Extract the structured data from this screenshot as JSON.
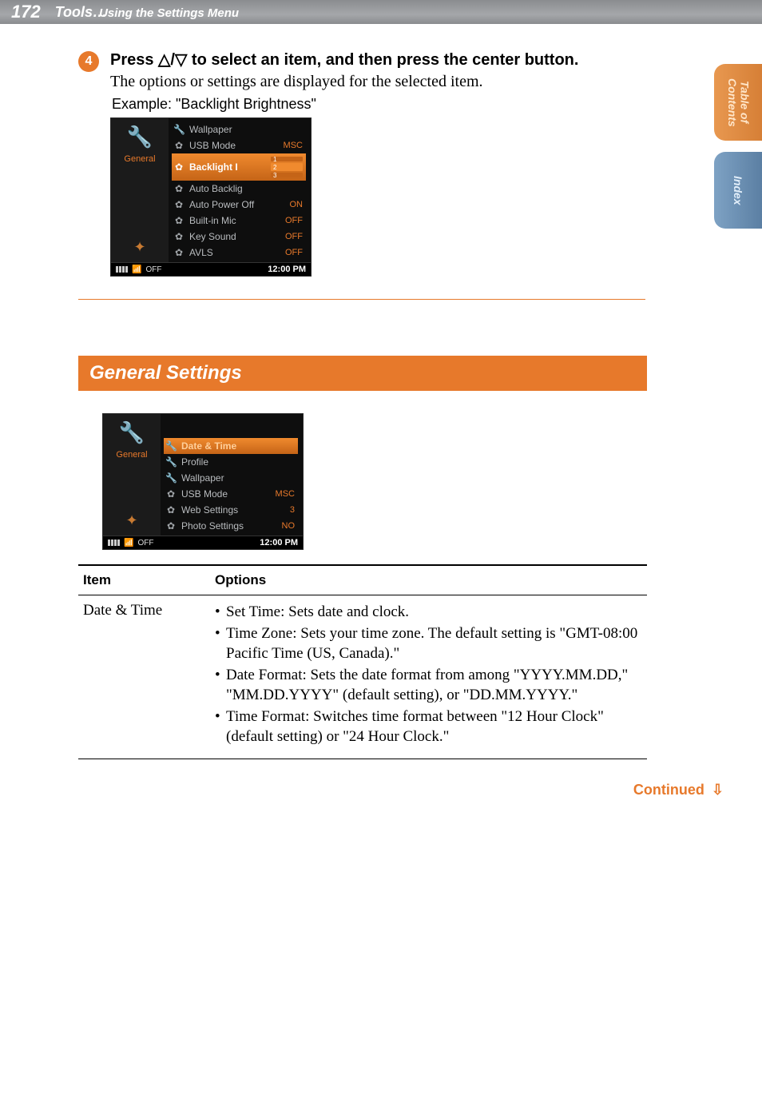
{
  "header": {
    "page_number": "172",
    "title": "Tools…",
    "subtitle": "Using the Settings Menu"
  },
  "side_tabs": {
    "toc": "Table of\nContents",
    "index": "Index"
  },
  "step": {
    "number": "4",
    "heading": "Press △/▽ to select an item, and then press the center button.",
    "body": "The options or settings are displayed for the selected item.",
    "example": "Example: \"Backlight Brightness\""
  },
  "device1": {
    "sidebar_label": "General",
    "rows": [
      {
        "icon": "🔧",
        "label": "Wallpaper",
        "value": ""
      },
      {
        "icon": "✿",
        "label": "USB Mode",
        "value": "MSC"
      },
      {
        "icon": "✿",
        "label": "Backlight I",
        "value": "",
        "hl": true,
        "notches": [
          "1",
          "2",
          "3"
        ]
      },
      {
        "icon": "✿",
        "label": "Auto Backlig",
        "value": ""
      },
      {
        "icon": "✿",
        "label": "Auto Power Off",
        "value": "ON"
      },
      {
        "icon": "✿",
        "label": "Built-in Mic",
        "value": "OFF"
      },
      {
        "icon": "✿",
        "label": "Key Sound",
        "value": "OFF"
      },
      {
        "icon": "✿",
        "label": "AVLS",
        "value": "OFF"
      }
    ],
    "status": {
      "off": "OFF",
      "clock": "12:00 PM"
    }
  },
  "section_heading": "General Settings",
  "device2": {
    "sidebar_label": "General",
    "rows": [
      {
        "icon": "🔧",
        "label": "Date & Time",
        "value": "",
        "hl": true
      },
      {
        "icon": "🔧",
        "label": "Profile",
        "value": ""
      },
      {
        "icon": "🔧",
        "label": "Wallpaper",
        "value": ""
      },
      {
        "icon": "✿",
        "label": "USB Mode",
        "value": "MSC"
      },
      {
        "icon": "✿",
        "label": "Web Settings",
        "value": "3"
      },
      {
        "icon": "✿",
        "label": "Photo Settings",
        "value": "NO"
      }
    ],
    "status": {
      "off": "OFF",
      "clock": "12:00 PM"
    }
  },
  "table": {
    "headers": {
      "item": "Item",
      "options": "Options"
    },
    "row": {
      "item": "Date & Time",
      "bullets": [
        "Set Time: Sets date and clock.",
        "Time Zone: Sets your time zone. The default setting is \"GMT-08:00 Pacific Time (US, Canada).\"",
        "Date Format: Sets the date format from among \"YYYY.MM.DD,\" \"MM.DD.YYYY\" (default setting), or \"DD.MM.YYYY.\"",
        "Time Format: Switches time format between \"12 Hour Clock\" (default setting) or \"24 Hour Clock.\""
      ]
    }
  },
  "continued": "Continued"
}
